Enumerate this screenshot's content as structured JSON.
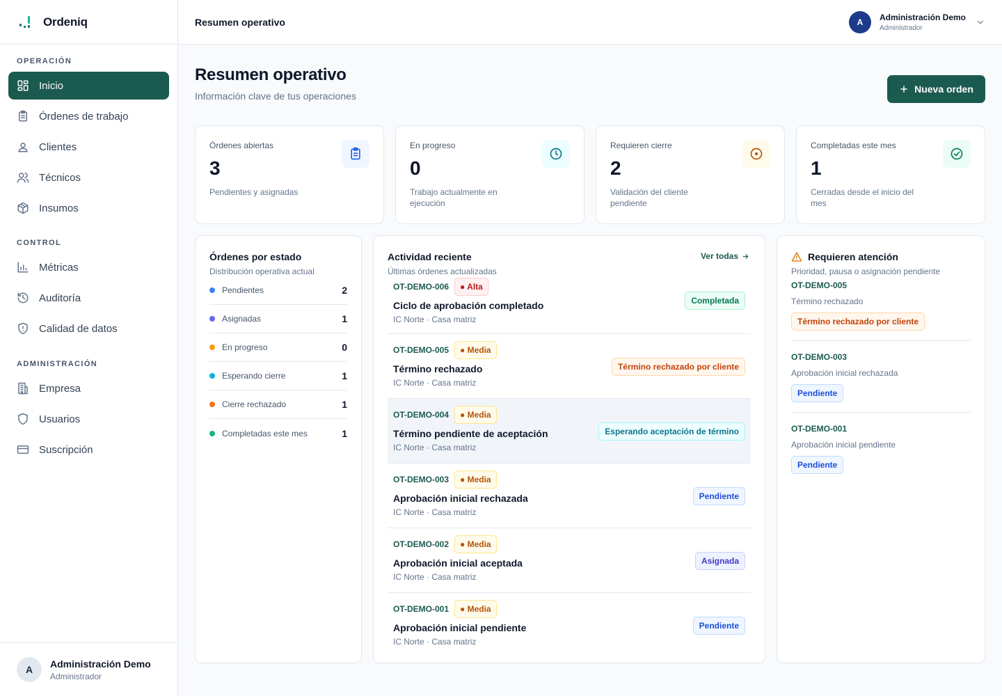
{
  "brand": {
    "name": "Ordeniq"
  },
  "sidebar": {
    "sections": [
      {
        "title": "OPERACIÓN",
        "items": [
          "Inicio",
          "Órdenes de trabajo",
          "Clientes",
          "Técnicos",
          "Insumos"
        ]
      },
      {
        "title": "CONTROL",
        "items": [
          "Métricas",
          "Auditoría",
          "Calidad de datos"
        ]
      },
      {
        "title": "ADMINISTRACIÓN",
        "items": [
          "Empresa",
          "Usuarios",
          "Suscripción"
        ]
      }
    ],
    "user": {
      "initial": "A",
      "name": "Administración Demo",
      "role": "Administrador"
    }
  },
  "header": {
    "title": "Resumen operativo",
    "user": {
      "initial": "A",
      "name": "Administración Demo",
      "role": "Administrador"
    }
  },
  "page": {
    "title": "Resumen operativo",
    "subtitle": "Información clave de tus operaciones",
    "new_order_label": "Nueva orden"
  },
  "stats": [
    {
      "label": "Órdenes abiertas",
      "value": "3",
      "desc": "Pendientes y asignadas",
      "icon": "clipboard-icon",
      "color": "#2563eb",
      "bg": "#eff6ff"
    },
    {
      "label": "En progreso",
      "value": "0",
      "desc": "Trabajo actualmente en ejecución",
      "icon": "clock-icon",
      "color": "#0e7490",
      "bg": "#ecfeff"
    },
    {
      "label": "Requieren cierre",
      "value": "2",
      "desc": "Validación del cliente pendiente",
      "icon": "target-icon",
      "color": "#b45309",
      "bg": "#fffbeb"
    },
    {
      "label": "Completadas este mes",
      "value": "1",
      "desc": "Cerradas desde el inicio del mes",
      "icon": "check-circle-icon",
      "color": "#047857",
      "bg": "#ecfdf5"
    }
  ],
  "status_panel": {
    "title": "Órdenes por estado",
    "subtitle": "Distribución operativa actual",
    "rows": [
      {
        "label": "Pendientes",
        "count": "2",
        "color": "#3b82f6"
      },
      {
        "label": "Asignadas",
        "count": "1",
        "color": "#6366f1"
      },
      {
        "label": "En progreso",
        "count": "0",
        "color": "#f59e0b"
      },
      {
        "label": "Esperando cierre",
        "count": "1",
        "color": "#06b6d4"
      },
      {
        "label": "Cierre rechazado",
        "count": "1",
        "color": "#f97316"
      },
      {
        "label": "Completadas este mes",
        "count": "1",
        "color": "#10b981"
      }
    ]
  },
  "activity": {
    "title": "Actividad reciente",
    "subtitle": "Últimas órdenes actualizadas",
    "link_label": "Ver todas",
    "rows": [
      {
        "code": "OT-DEMO-006",
        "priority": "● Alta",
        "priority_kind": "alta",
        "title": "Ciclo de aprobación completado",
        "meta": "IC Norte · Casa matriz",
        "status": "Completada",
        "status_kind": "done"
      },
      {
        "code": "OT-DEMO-005",
        "priority": "● Media",
        "priority_kind": "media",
        "title": "Término rechazado",
        "meta": "IC Norte · Casa matriz",
        "status": "Término rechazado por cliente",
        "status_kind": "rejected"
      },
      {
        "code": "OT-DEMO-004",
        "priority": "● Media",
        "priority_kind": "media",
        "title": "Término pendiente de aceptación",
        "meta": "IC Norte · Casa matriz",
        "status": "Esperando aceptación de término",
        "status_kind": "waiting",
        "highlight": true
      },
      {
        "code": "OT-DEMO-003",
        "priority": "● Media",
        "priority_kind": "media",
        "title": "Aprobación inicial rechazada",
        "meta": "IC Norte · Casa matriz",
        "status": "Pendiente",
        "status_kind": "pending"
      },
      {
        "code": "OT-DEMO-002",
        "priority": "● Media",
        "priority_kind": "media",
        "title": "Aprobación inicial aceptada",
        "meta": "IC Norte · Casa matriz",
        "status": "Asignada",
        "status_kind": "assigned"
      },
      {
        "code": "OT-DEMO-001",
        "priority": "● Media",
        "priority_kind": "media",
        "title": "Aprobación inicial pendiente",
        "meta": "IC Norte · Casa matriz",
        "status": "Pendiente",
        "status_kind": "pending"
      }
    ]
  },
  "attention": {
    "title": "Requieren atención",
    "subtitle": "Prioridad, pausa o asignación pendiente",
    "items": [
      {
        "code": "OT-DEMO-005",
        "desc": "Término rechazado",
        "status": "Término rechazado por cliente",
        "status_kind": "rejected"
      },
      {
        "code": "OT-DEMO-003",
        "desc": "Aprobación inicial rechazada",
        "status": "Pendiente",
        "status_kind": "pending"
      },
      {
        "code": "OT-DEMO-001",
        "desc": "Aprobación inicial pendiente",
        "status": "Pendiente",
        "status_kind": "pending"
      }
    ]
  }
}
